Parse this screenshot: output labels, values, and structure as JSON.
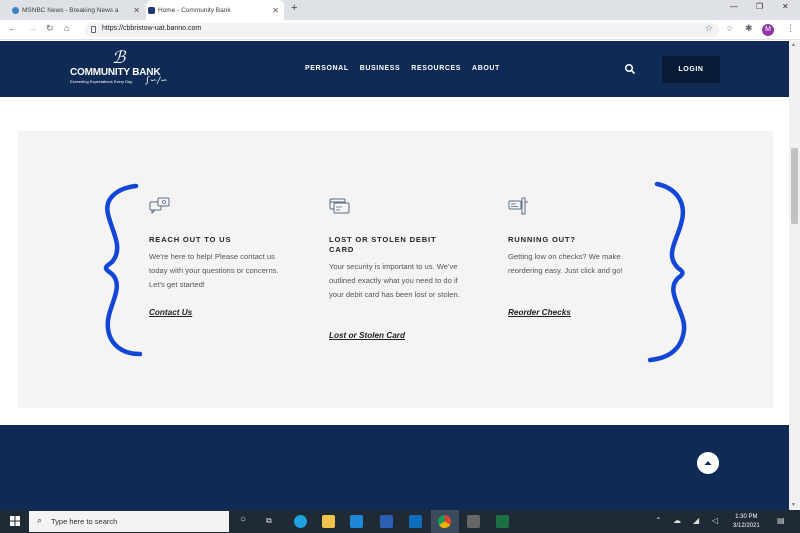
{
  "browser": {
    "tabs": [
      {
        "title": "MSNBC News - Breaking News a",
        "active": false
      },
      {
        "title": "Home - Community Bank",
        "active": true
      }
    ],
    "url": "https://cbbristow-uat.banno.com",
    "profile_initial": "M"
  },
  "site": {
    "logo": {
      "name": "COMMUNITY BANK",
      "tagline": "Exceeding Expectations Every Day"
    },
    "nav": [
      "PERSONAL",
      "BUSINESS",
      "RESOURCES",
      "ABOUT"
    ],
    "login_label": "LOGIN"
  },
  "cards": [
    {
      "icon": "chat-bubbles-icon",
      "title": "REACH OUT TO US",
      "body": "We're here to help! Please contact us today with your questions or concerns. Let's get started!",
      "link": "Contact Us"
    },
    {
      "icon": "debit-card-icon",
      "title": "LOST OR STOLEN DEBIT CARD",
      "body": "Your security is important to us. We've outlined exactly what you need to do if your debit card has been lost or stolen.",
      "link": "Lost or Stolen Card"
    },
    {
      "icon": "check-hand-icon",
      "title": "RUNNING OUT?",
      "body": "Getting low on checks? We make reordering easy. Just click and go!",
      "link": "Reorder Checks"
    }
  ],
  "taskbar": {
    "search_placeholder": "Type here to search",
    "time": "1:30 PM",
    "date": "3/12/2021"
  },
  "colors": {
    "navy": "#0f2a55",
    "login_bg": "#071a36",
    "card_bg": "#f4f4f4",
    "annotation": "#1246d6"
  }
}
